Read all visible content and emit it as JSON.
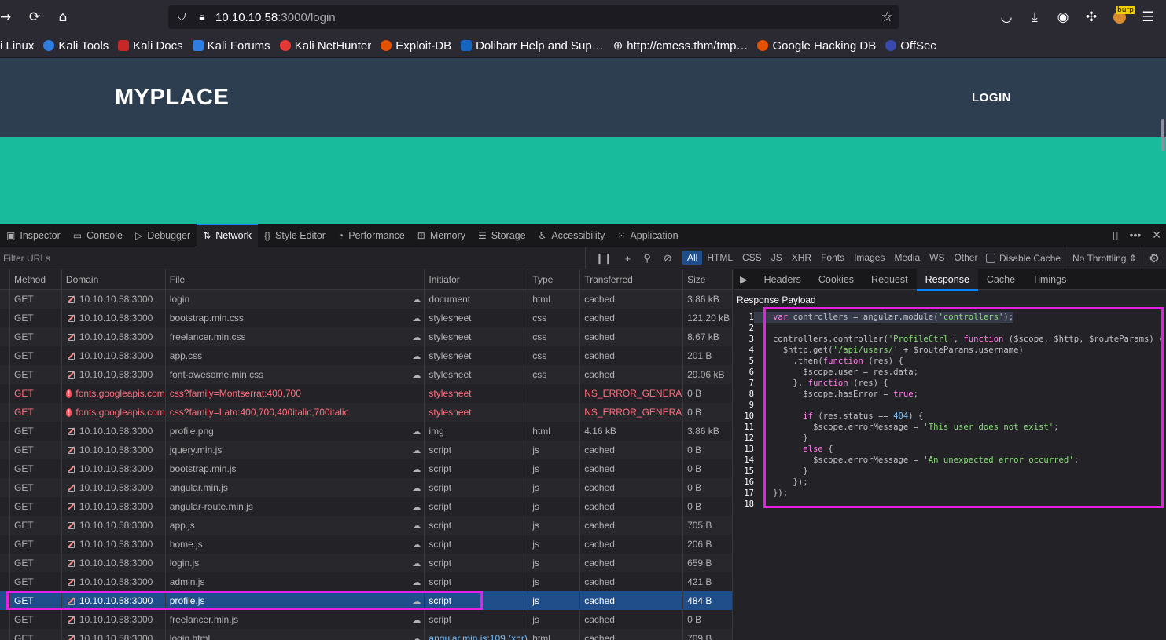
{
  "browser": {
    "url_host": "10.10.10.58",
    "url_rest": ":3000/login",
    "bookmarks": [
      "i Linux",
      "Kali Tools",
      "Kali Docs",
      "Kali Forums",
      "Kali NetHunter",
      "Exploit-DB",
      "Dolibarr Help and Sup…",
      "http://cmess.thm/tmp…",
      "Google Hacking DB",
      "OffSec"
    ],
    "burp_badge": "burp"
  },
  "page": {
    "brand": "MYPLACE",
    "nav_login": "LOGIN",
    "navbar_color": "#2c3e50",
    "hero_color": "#18bc9c"
  },
  "devtools": {
    "tabs": [
      "Inspector",
      "Console",
      "Debugger",
      "Network",
      "Style Editor",
      "Performance",
      "Memory",
      "Storage",
      "Accessibility",
      "Application"
    ],
    "active_tab": "Network",
    "filter_placeholder": "Filter URLs",
    "type_filters": [
      "All",
      "HTML",
      "CSS",
      "JS",
      "XHR",
      "Fonts",
      "Images",
      "Media",
      "WS",
      "Other"
    ],
    "disable_cache": "Disable Cache",
    "throttling": "No Throttling ⇕",
    "columns": [
      "Method",
      "Domain",
      "File",
      "Initiator",
      "Type",
      "Transferred",
      "Size"
    ],
    "requests": [
      {
        "method": "GET",
        "domain": "10.10.10.58:3000",
        "file": "login",
        "initiator": "document",
        "type": "html",
        "transferred": "cached",
        "size": "3.86 kB"
      },
      {
        "method": "GET",
        "domain": "10.10.10.58:3000",
        "file": "bootstrap.min.css",
        "initiator": "stylesheet",
        "type": "css",
        "transferred": "cached",
        "size": "121.20 kB"
      },
      {
        "method": "GET",
        "domain": "10.10.10.58:3000",
        "file": "freelancer.min.css",
        "initiator": "stylesheet",
        "type": "css",
        "transferred": "cached",
        "size": "8.67 kB"
      },
      {
        "method": "GET",
        "domain": "10.10.10.58:3000",
        "file": "app.css",
        "initiator": "stylesheet",
        "type": "css",
        "transferred": "cached",
        "size": "201 B"
      },
      {
        "method": "GET",
        "domain": "10.10.10.58:3000",
        "file": "font-awesome.min.css",
        "initiator": "stylesheet",
        "type": "css",
        "transferred": "cached",
        "size": "29.06 kB"
      },
      {
        "method": "GET",
        "domain": "fonts.googleapis.com",
        "file": "css?family=Montserrat:400,700",
        "initiator": "stylesheet",
        "type": "",
        "transferred": "NS_ERROR_GENERAT…",
        "size": "0 B",
        "error": true
      },
      {
        "method": "GET",
        "domain": "fonts.googleapis.com",
        "file": "css?family=Lato:400,700,400italic,700italic",
        "initiator": "stylesheet",
        "type": "",
        "transferred": "NS_ERROR_GENERAT…",
        "size": "0 B",
        "error": true
      },
      {
        "method": "GET",
        "domain": "10.10.10.58:3000",
        "file": "profile.png",
        "initiator": "img",
        "type": "html",
        "transferred": "4.16 kB",
        "size": "3.86 kB"
      },
      {
        "method": "GET",
        "domain": "10.10.10.58:3000",
        "file": "jquery.min.js",
        "initiator": "script",
        "type": "js",
        "transferred": "cached",
        "size": "0 B"
      },
      {
        "method": "GET",
        "domain": "10.10.10.58:3000",
        "file": "bootstrap.min.js",
        "initiator": "script",
        "type": "js",
        "transferred": "cached",
        "size": "0 B"
      },
      {
        "method": "GET",
        "domain": "10.10.10.58:3000",
        "file": "angular.min.js",
        "initiator": "script",
        "type": "js",
        "transferred": "cached",
        "size": "0 B"
      },
      {
        "method": "GET",
        "domain": "10.10.10.58:3000",
        "file": "angular-route.min.js",
        "initiator": "script",
        "type": "js",
        "transferred": "cached",
        "size": "0 B"
      },
      {
        "method": "GET",
        "domain": "10.10.10.58:3000",
        "file": "app.js",
        "initiator": "script",
        "type": "js",
        "transferred": "cached",
        "size": "705 B"
      },
      {
        "method": "GET",
        "domain": "10.10.10.58:3000",
        "file": "home.js",
        "initiator": "script",
        "type": "js",
        "transferred": "cached",
        "size": "206 B"
      },
      {
        "method": "GET",
        "domain": "10.10.10.58:3000",
        "file": "login.js",
        "initiator": "script",
        "type": "js",
        "transferred": "cached",
        "size": "659 B"
      },
      {
        "method": "GET",
        "domain": "10.10.10.58:3000",
        "file": "admin.js",
        "initiator": "script",
        "type": "js",
        "transferred": "cached",
        "size": "421 B"
      },
      {
        "method": "GET",
        "domain": "10.10.10.58:3000",
        "file": "profile.js",
        "initiator": "script",
        "type": "js",
        "transferred": "cached",
        "size": "484 B",
        "selected": true
      },
      {
        "method": "GET",
        "domain": "10.10.10.58:3000",
        "file": "freelancer.min.js",
        "initiator": "script",
        "type": "js",
        "transferred": "cached",
        "size": "0 B"
      },
      {
        "method": "GET",
        "domain": "10.10.10.58:3000",
        "file": "login.html",
        "initiator": "angular.min.js:109 (xhr)",
        "type": "html",
        "transferred": "cached",
        "size": "709 B"
      }
    ],
    "side_tabs": [
      "Headers",
      "Cookies",
      "Request",
      "Response",
      "Cache",
      "Timings"
    ],
    "active_side_tab": "Response",
    "payload_label": "Response Payload",
    "code_lines": [
      "var controllers = angular.module('controllers');",
      "",
      "controllers.controller('ProfileCtrl', function ($scope, $http, $routeParams) {",
      "  $http.get('/api/users/' + $routeParams.username)",
      "    .then(function (res) {",
      "      $scope.user = res.data;",
      "    }, function (res) {",
      "      $scope.hasError = true;",
      "",
      "      if (res.status == 404) {",
      "        $scope.errorMessage = 'This user does not exist';",
      "      }",
      "      else {",
      "        $scope.errorMessage = 'An unexpected error occurred';",
      "      }",
      "    });",
      "});",
      ""
    ],
    "highlight_color": "#e91ee3"
  }
}
